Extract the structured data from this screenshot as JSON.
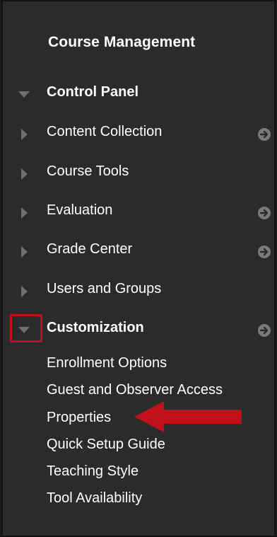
{
  "panel": {
    "title": "Course Management",
    "items": [
      {
        "label": "Control Panel",
        "expanded": true,
        "bold": true,
        "has_go": false
      },
      {
        "label": "Content Collection",
        "expanded": false,
        "bold": false,
        "has_go": true
      },
      {
        "label": "Course Tools",
        "expanded": false,
        "bold": false,
        "has_go": false
      },
      {
        "label": "Evaluation",
        "expanded": false,
        "bold": false,
        "has_go": true
      },
      {
        "label": "Grade Center",
        "expanded": false,
        "bold": false,
        "has_go": true
      },
      {
        "label": "Users and Groups",
        "expanded": false,
        "bold": false,
        "has_go": false
      },
      {
        "label": "Customization",
        "expanded": true,
        "bold": true,
        "has_go": true
      }
    ],
    "customization_subitems": [
      "Enrollment Options",
      "Guest and Observer Access",
      "Properties",
      "Quick Setup Guide",
      "Teaching Style",
      "Tool Availability"
    ]
  },
  "colors": {
    "background": "#2b2b2b",
    "text": "#ffffff",
    "triangle": "#6f6f6f",
    "go_icon": "#7a7a7a",
    "highlight": "#c0101a"
  },
  "icons": {
    "collapsed": "triangle-right-icon",
    "expanded": "triangle-down-icon",
    "go": "arrow-circle-right-icon",
    "annotation": "red-arrow-pointer"
  }
}
